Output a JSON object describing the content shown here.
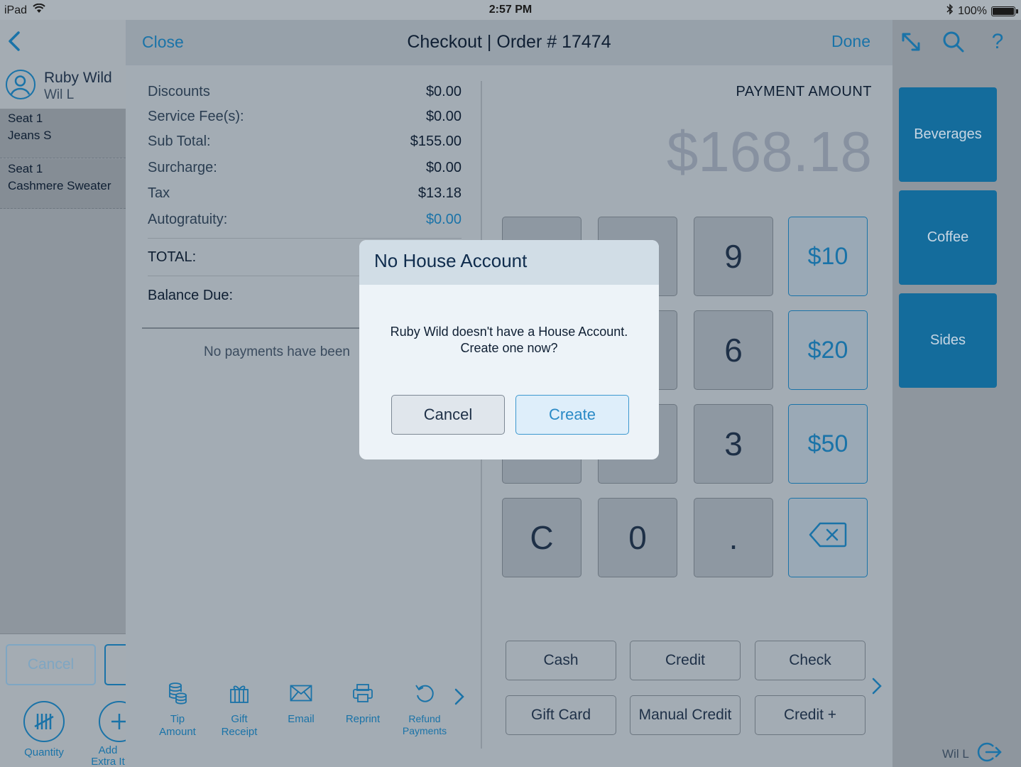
{
  "status_bar": {
    "device": "iPad",
    "time": "2:57 PM",
    "battery": "100%"
  },
  "order_panel": {
    "customer_name": "Ruby Wild",
    "server_name": "Wil L",
    "items": [
      {
        "seat": "Seat 1",
        "name": "Jeans S"
      },
      {
        "seat": "Seat 1",
        "name": "Cashmere Sweater"
      }
    ],
    "cancel_label": "Cancel",
    "tools": [
      {
        "label": "Quantity"
      },
      {
        "label": "Add Extra It"
      }
    ]
  },
  "checkout": {
    "close_label": "Close",
    "title": "Checkout | Order # 17474",
    "done_label": "Done",
    "summary": [
      {
        "label": "Discounts",
        "value": "$0.00"
      },
      {
        "label": "Service Fee(s):",
        "value": "$0.00"
      },
      {
        "label": "Sub Total:",
        "value": "$155.00"
      },
      {
        "label": "Surcharge:",
        "value": "$0.00"
      },
      {
        "label": "Tax",
        "value": "$13.18"
      },
      {
        "label": "Autogratuity:",
        "value": "$0.00"
      }
    ],
    "total_label": "TOTAL:",
    "balance_label": "Balance Due:",
    "no_payments_text": "No payments have been",
    "tools": [
      {
        "label": "Tip Amount",
        "icon": "coins-icon"
      },
      {
        "label": "Gift Receipt",
        "icon": "gift-icon"
      },
      {
        "label": "Email",
        "icon": "envelope-icon"
      },
      {
        "label": "Reprint",
        "icon": "printer-icon"
      },
      {
        "label": "Refund Payments",
        "icon": "refund-icon"
      }
    ],
    "payment_amount_label": "PAYMENT AMOUNT",
    "payment_amount": "$168.18",
    "keypad": {
      "k9": "9",
      "k6": "6",
      "k3": "3",
      "kC": "C",
      "k0": "0",
      "kdot": ".",
      "q10": "$10",
      "q20": "$20",
      "q50": "$50"
    },
    "payment_methods": [
      "Cash",
      "Credit",
      "Check",
      "Gift Card",
      "Manual Credit",
      "Credit +"
    ]
  },
  "categories": [
    "Beverages",
    "Coffee",
    "Sides"
  ],
  "footer_user": "Wil L",
  "dialog": {
    "title": "No House Account",
    "message": "Ruby Wild doesn't have a House Account. Create one now?",
    "cancel_label": "Cancel",
    "create_label": "Create"
  },
  "colors": {
    "accent": "#1a73a8",
    "category_tile": "#146c9c",
    "dialog_bg": "#edf3f8",
    "dialog_header": "#d1dde6"
  }
}
